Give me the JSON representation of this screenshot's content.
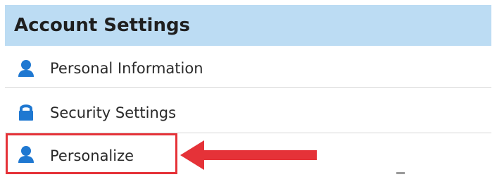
{
  "header": {
    "title": "Account Settings",
    "background": "#bcdcf3"
  },
  "items": [
    {
      "label": "Personal Information",
      "icon": "user-icon"
    },
    {
      "label": "Security Settings",
      "icon": "lock-icon"
    },
    {
      "label": "Personalize",
      "icon": "user-icon",
      "highlighted": true
    }
  ],
  "annotation": {
    "highlight_color": "#e53238",
    "arrow_icon": "arrow-left-icon"
  },
  "colors": {
    "icon_blue": "#1f78d1",
    "divider": "#d7d7d7"
  }
}
